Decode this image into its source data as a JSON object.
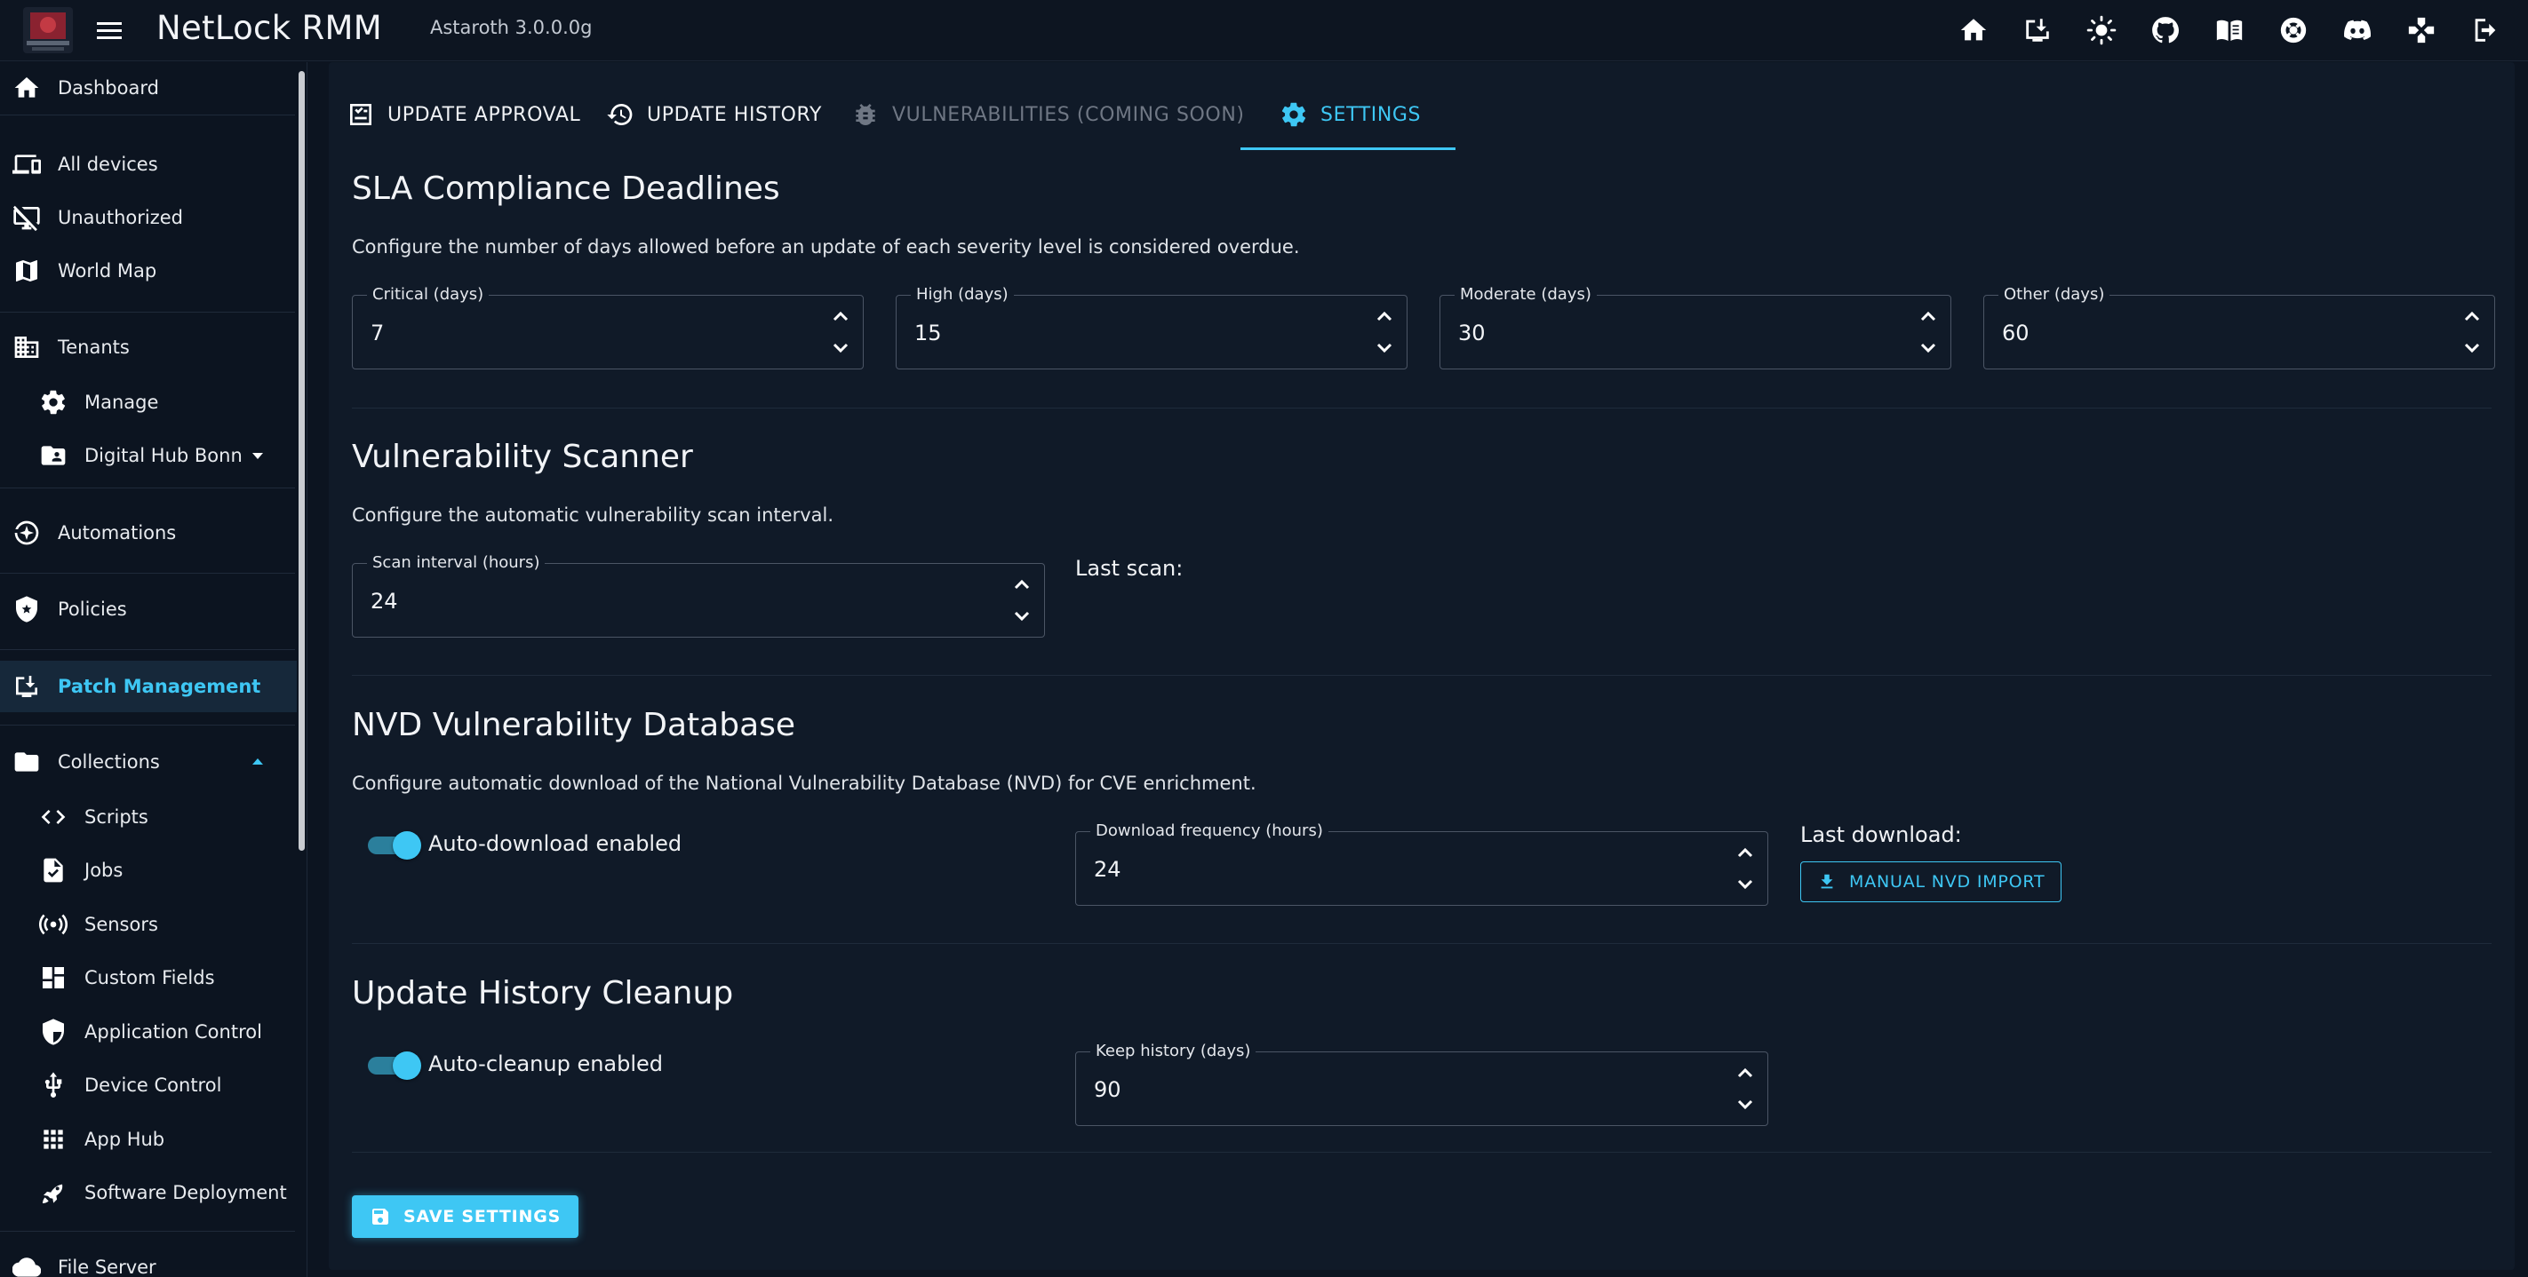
{
  "app": {
    "title": "NetLock RMM",
    "version": "Astaroth 3.0.0.0g"
  },
  "topbar_icons": [
    "home-icon",
    "download-icon",
    "theme-icon",
    "github-icon",
    "docs-icon",
    "support-icon",
    "discord-icon",
    "gamepad-icon",
    "logout-icon"
  ],
  "sidebar": {
    "dashboard": "Dashboard",
    "all_devices": "All devices",
    "unauthorized": "Unauthorized",
    "world_map": "World Map",
    "tenants": "Tenants",
    "manage": "Manage",
    "digital_hub": "Digital Hub Bonn",
    "automations": "Automations",
    "policies": "Policies",
    "patch_management": "Patch Management",
    "collections": "Collections",
    "scripts": "Scripts",
    "jobs": "Jobs",
    "sensors": "Sensors",
    "custom_fields": "Custom Fields",
    "application_control": "Application Control",
    "device_control": "Device Control",
    "app_hub": "App Hub",
    "software_deployment": "Software Deployment",
    "file_server": "File Server"
  },
  "tabs": {
    "update_approval": "UPDATE APPROVAL",
    "update_history": "UPDATE HISTORY",
    "vulnerabilities": "VULNERABILITIES (COMING SOON)",
    "settings": "SETTINGS"
  },
  "sla": {
    "title": "SLA Compliance Deadlines",
    "description": "Configure the number of days allowed before an update of each severity level is considered overdue.",
    "critical_label": "Critical (days)",
    "critical_value": "7",
    "high_label": "High (days)",
    "high_value": "15",
    "moderate_label": "Moderate (days)",
    "moderate_value": "30",
    "other_label": "Other (days)",
    "other_value": "60"
  },
  "scanner": {
    "title": "Vulnerability Scanner",
    "description": "Configure the automatic vulnerability scan interval.",
    "interval_label": "Scan interval (hours)",
    "interval_value": "24",
    "last_scan": "Last scan:"
  },
  "nvd": {
    "title": "NVD Vulnerability Database",
    "description": "Configure automatic download of the National Vulnerability Database (NVD) for CVE enrichment.",
    "auto_download": "Auto-download enabled",
    "frequency_label": "Download frequency (hours)",
    "frequency_value": "24",
    "last_download": "Last download:",
    "manual_import": "MANUAL NVD IMPORT"
  },
  "cleanup": {
    "title": "Update History Cleanup",
    "auto_cleanup": "Auto-cleanup enabled",
    "keep_label": "Keep history (days)",
    "keep_value": "90"
  },
  "save_label": "SAVE SETTINGS",
  "colors": {
    "accent": "#3ec7f4",
    "background": "#0c1420",
    "panel": "#101a28"
  }
}
